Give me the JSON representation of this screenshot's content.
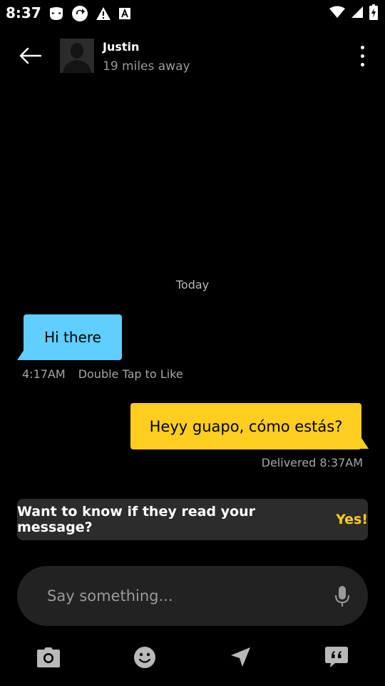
{
  "status_bar": {
    "time": "8:37",
    "left_icons": [
      "grindr-mask-icon",
      "sync-icon",
      "warning-icon",
      "text-a-icon"
    ],
    "right_icons": [
      "wifi-icon",
      "cell-signal-icon",
      "battery-icon"
    ]
  },
  "header": {
    "contact_name": "Justin",
    "distance": "19 miles away"
  },
  "chat": {
    "date_label": "Today",
    "incoming": {
      "text": "Hi there",
      "time": "4:17AM",
      "hint": "Double Tap to Like"
    },
    "outgoing": {
      "text": "Heyy guapo, cómo estás?",
      "status": "Delivered 8:37AM"
    }
  },
  "upsell": {
    "question": "Want to know if they read your message?",
    "cta": "Yes!"
  },
  "composer": {
    "placeholder": "Say something..."
  },
  "colors": {
    "incoming_bubble": "#60ceff",
    "outgoing_bubble": "#fdcd1f",
    "cta": "#fdcd1f",
    "background": "#000000"
  }
}
